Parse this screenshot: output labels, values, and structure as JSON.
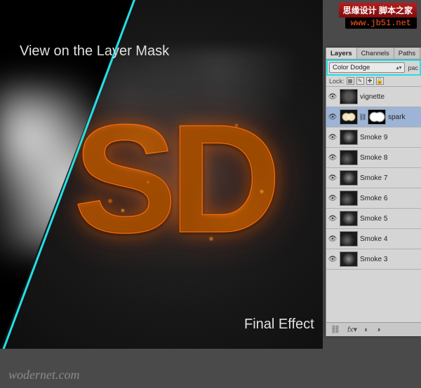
{
  "canvas": {
    "mask_label": "View on the Layer Mask",
    "final_label": "Final Effect",
    "text_sd": "SD"
  },
  "panel": {
    "tabs": {
      "layers": "Layers",
      "channels": "Channels",
      "paths": "Paths"
    },
    "blend_mode": "Color Dodge",
    "opacity_short": "pac",
    "lock_label": "Lock:",
    "layers": [
      {
        "name": "vignette"
      },
      {
        "name": "spark"
      },
      {
        "name": "Smoke 9"
      },
      {
        "name": "Smoke 8"
      },
      {
        "name": "Smoke 7"
      },
      {
        "name": "Smoke 6"
      },
      {
        "name": "Smoke 5"
      },
      {
        "name": "Smoke 4"
      },
      {
        "name": "Smoke 3"
      }
    ]
  },
  "watermark": {
    "top_cn": "思缘设计  脚本之家",
    "top_url": "www.jb51.net",
    "bottom": "wodernet.com"
  }
}
